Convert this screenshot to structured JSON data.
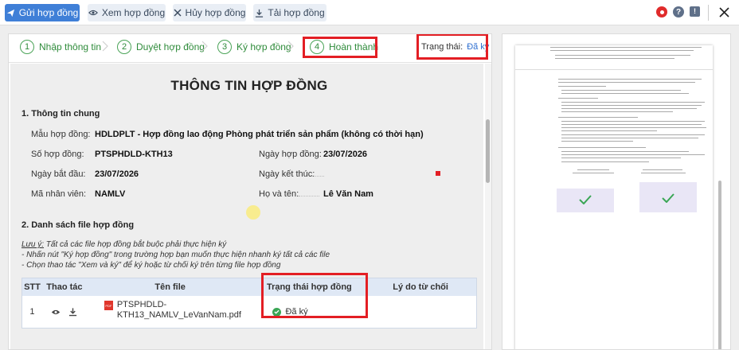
{
  "toolbar": {
    "send_label": "Gửi hợp đồng",
    "view_label": "Xem hợp đồng",
    "cancel_label": "Hủy hợp đồng",
    "download_label": "Tải hợp đồng"
  },
  "steps": [
    {
      "num": "1",
      "label": "Nhập thông tin"
    },
    {
      "num": "2",
      "label": "Duyệt hợp đồng"
    },
    {
      "num": "3",
      "label": "Ký hợp đồng"
    },
    {
      "num": "4",
      "label": "Hoàn thành"
    }
  ],
  "status": {
    "label": "Trạng thái:",
    "value": "Đã ký"
  },
  "doc": {
    "title": "THÔNG TIN HỢP ĐỒNG",
    "section1": "1. Thông tin chung",
    "template_label": "Mẫu hợp đồng:",
    "template_value": "HDLDPLT - Hợp đồng lao động Phòng phát triển sản phẩm (không có thời hạn)",
    "number_label": "Số hợp đồng:",
    "number_value": "PTSPHDLD-KTH13",
    "date_label": "Ngày hợp đồng:",
    "date_value": "23/07/2026",
    "start_label": "Ngày bắt đầu:",
    "start_value": "23/07/2026",
    "end_label": "Ngày kết thúc:",
    "emp_label": "Mã nhân viên:",
    "emp_value": "NAMLV",
    "name_label": "Họ và tên:",
    "name_value": "Lê Văn Nam",
    "section2": "2. Danh sách file hợp đồng",
    "note_title": "Lưu ý:",
    "note1": " Tất cả các file hợp đồng bắt buộc phải thực hiện ký",
    "note2": "- Nhấn nút \"Ký hợp đồng\" trong trường hợp bạn muốn thực hiện nhanh ký tất cả các file",
    "note3": "- Chọn thao tác \"Xem và ký\" để ký hoặc từ chối ký trên từng file hợp đồng"
  },
  "table": {
    "headers": [
      "STT",
      "Thao tác",
      "Tên file",
      "Trạng thái hợp đồng",
      "Lý do từ chối"
    ],
    "rows": [
      {
        "stt": "1",
        "file_line1": "PTSPHDLD-",
        "file_line2": "KTH13_NAMLV_LeVanNam.pdf",
        "file_badge": "PDF",
        "status": "Đã ký",
        "reason": ""
      }
    ]
  },
  "colors": {
    "primary": "#3f7fd7",
    "step_green": "#2e8b3a",
    "highlight_red": "#e31e24",
    "status_blue": "#2f6fd0",
    "signed_green": "#3aa655"
  }
}
